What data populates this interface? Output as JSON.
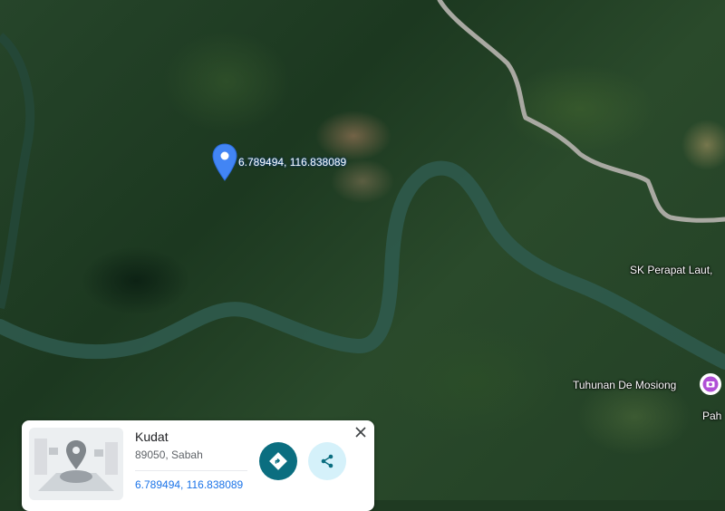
{
  "map": {
    "dropped_pin": {
      "coordinates": "6.789494, 116.838089"
    },
    "labels": {
      "school": "SK Perapat Laut,",
      "poi": "Tuhunan De Mosiong",
      "partial": "Pah"
    },
    "icons": {
      "pin": "location-pin-icon",
      "poi": "camera-icon"
    }
  },
  "card": {
    "title": "Kudat",
    "subtitle": "89050, Sabah",
    "coordinates": "6.789494, 116.838089",
    "icons": {
      "thumbnail": "street-view-placeholder-icon",
      "directions": "directions-icon",
      "share": "share-icon",
      "close": "close-icon"
    }
  },
  "colors": {
    "pin": "#4285f4",
    "directions_button": "#0b6e80",
    "share_button": "#d5f1fa",
    "link": "#1a73e8",
    "river": "#2f5a4c",
    "road": "#a9a9a2"
  }
}
